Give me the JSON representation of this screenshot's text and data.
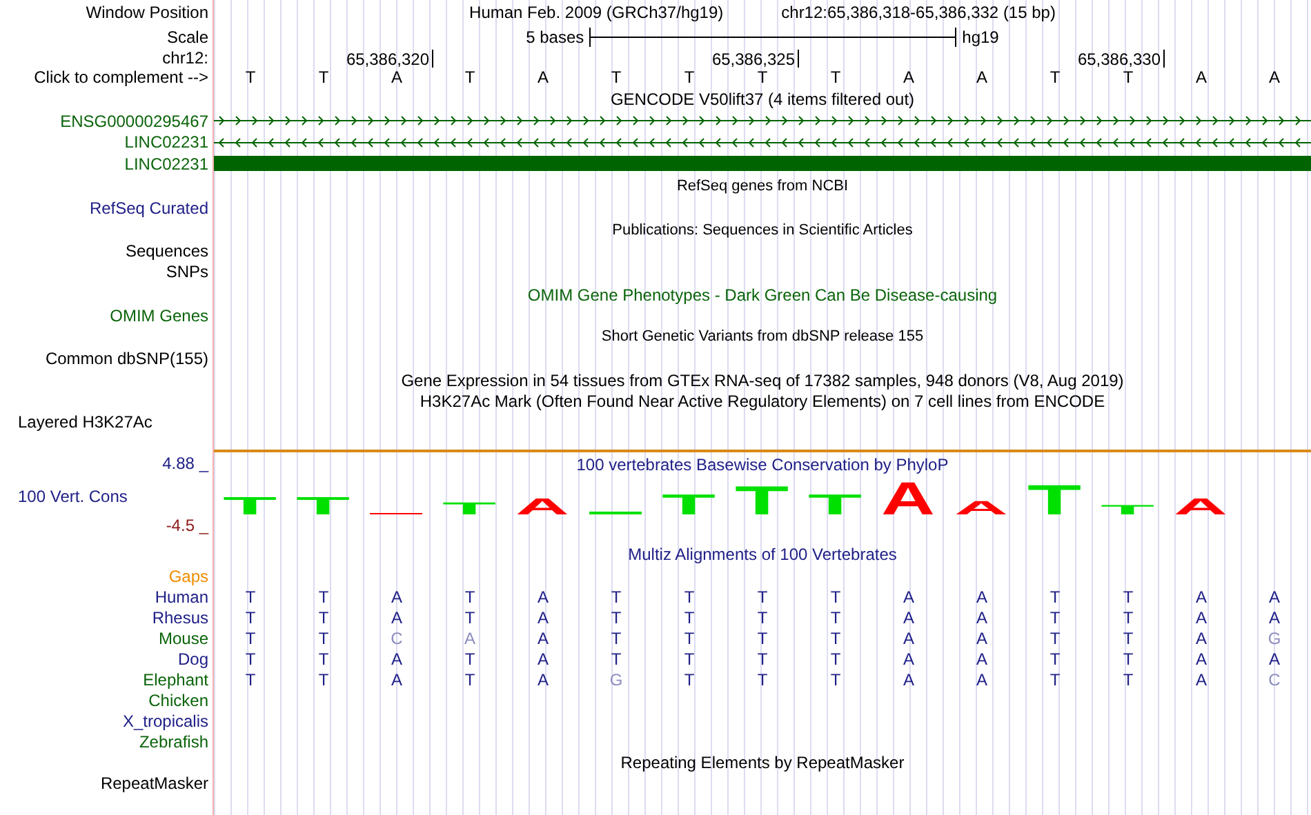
{
  "ruler": {
    "position_label": "Window Position",
    "assembly": "Human Feb. 2009 (GRCh37/hg19)",
    "position": "chr12:65,386,318-65,386,332 (15 bp)",
    "scale_label": "Scale",
    "scale_text": "5 bases",
    "scale_assembly": "hg19",
    "chrom_label": "chr12:",
    "complement_label": "Click to complement -->",
    "bases": [
      {
        "base": "T"
      },
      {
        "base": "T"
      },
      {
        "base": "A",
        "tick": "65,386,320"
      },
      {
        "base": "T"
      },
      {
        "base": "A"
      },
      {
        "base": "T"
      },
      {
        "base": "T"
      },
      {
        "base": "T",
        "tick": "65,386,325"
      },
      {
        "base": "T"
      },
      {
        "base": "A"
      },
      {
        "base": "A"
      },
      {
        "base": "T"
      },
      {
        "base": "T",
        "tick": "65,386,330"
      },
      {
        "base": "A"
      },
      {
        "base": "A"
      }
    ]
  },
  "gencode": {
    "title": "GENCODE V50lift37 (4 items filtered out)",
    "items": [
      {
        "name": "ENSG00000295467",
        "kind": "forward"
      },
      {
        "name": "LINC02231",
        "kind": "reverse"
      },
      {
        "name": "LINC02231",
        "kind": "exon"
      }
    ]
  },
  "refseq": {
    "title": "RefSeq genes from NCBI",
    "label": "RefSeq Curated"
  },
  "publications": {
    "title": "Publications: Sequences in Scientific Articles",
    "labels": [
      "Sequences",
      "SNPs"
    ]
  },
  "omim": {
    "title": "OMIM Gene Phenotypes - Dark Green Can Be Disease-causing",
    "label": "OMIM Genes"
  },
  "dbsnp": {
    "title": "Short Genetic Variants from dbSNP release 155",
    "label": "Common dbSNP(155)"
  },
  "gtex": {
    "title": "Gene Expression in 54 tissues from GTEx RNA-seq of 17382 samples, 948 donors (V8, Aug 2019)"
  },
  "h3k27ac": {
    "title": "H3K27Ac Mark (Often Found Near Active Regulatory Elements) on 7 cell lines from ENCODE",
    "label": "Layered H3K27Ac"
  },
  "conservation": {
    "title": "100 vertebrates Basewise Conservation by PhyloP",
    "label": "100 Vert. Cons",
    "max": "4.88 _",
    "min": "-4.5 _",
    "logo": [
      {
        "base": "T",
        "kind": "conserved"
      },
      {
        "base": "T",
        "kind": "conserved"
      },
      {
        "kind": "accelerated"
      },
      {
        "base": "T",
        "kind": "conserved"
      },
      {
        "base": "A",
        "kind": "accelerated"
      },
      {
        "kind": "conserved"
      },
      {
        "base": "T",
        "kind": "conserved"
      },
      {
        "base": "T",
        "kind": "conserved"
      },
      {
        "base": "T",
        "kind": "conserved"
      },
      {
        "base": "A",
        "kind": "accelerated"
      },
      {
        "base": "A",
        "kind": "accelerated"
      },
      {
        "base": "T",
        "kind": "conserved"
      },
      {
        "base": "T",
        "kind": "conserved"
      },
      {
        "base": "A",
        "kind": "accelerated"
      }
    ]
  },
  "multiz": {
    "title": "Multiz Alignments of 100 Vertebrates",
    "gaps_label": "Gaps",
    "species": [
      {
        "name": "Human",
        "color": "#202088",
        "bases": [
          {
            "base": "T",
            "mismatch": false
          },
          {
            "base": "T",
            "mismatch": false
          },
          {
            "base": "A",
            "mismatch": false
          },
          {
            "base": "T",
            "mismatch": false
          },
          {
            "base": "A",
            "mismatch": false
          },
          {
            "base": "T",
            "mismatch": false
          },
          {
            "base": "T",
            "mismatch": false
          },
          {
            "base": "T",
            "mismatch": false
          },
          {
            "base": "T",
            "mismatch": false
          },
          {
            "base": "A",
            "mismatch": false
          },
          {
            "base": "A",
            "mismatch": false
          },
          {
            "base": "T",
            "mismatch": false
          },
          {
            "base": "T",
            "mismatch": false
          },
          {
            "base": "A",
            "mismatch": false
          },
          {
            "base": "A",
            "mismatch": false
          }
        ]
      },
      {
        "name": "Rhesus",
        "color": "#202088",
        "bases": [
          {
            "base": "T",
            "mismatch": false
          },
          {
            "base": "T",
            "mismatch": false
          },
          {
            "base": "A",
            "mismatch": false
          },
          {
            "base": "T",
            "mismatch": false
          },
          {
            "base": "A",
            "mismatch": false
          },
          {
            "base": "T",
            "mismatch": false
          },
          {
            "base": "T",
            "mismatch": false
          },
          {
            "base": "T",
            "mismatch": false
          },
          {
            "base": "T",
            "mismatch": false
          },
          {
            "base": "A",
            "mismatch": false
          },
          {
            "base": "A",
            "mismatch": false
          },
          {
            "base": "T",
            "mismatch": false
          },
          {
            "base": "T",
            "mismatch": false
          },
          {
            "base": "A",
            "mismatch": false
          },
          {
            "base": "A",
            "mismatch": false
          }
        ]
      },
      {
        "name": "Mouse",
        "color": "#0a640a",
        "bases": [
          {
            "base": "T",
            "mismatch": false
          },
          {
            "base": "T",
            "mismatch": false
          },
          {
            "base": "C",
            "mismatch": true
          },
          {
            "base": "A",
            "mismatch": true
          },
          {
            "base": "A",
            "mismatch": false
          },
          {
            "base": "T",
            "mismatch": false
          },
          {
            "base": "T",
            "mismatch": false
          },
          {
            "base": "T",
            "mismatch": false
          },
          {
            "base": "T",
            "mismatch": false
          },
          {
            "base": "A",
            "mismatch": false
          },
          {
            "base": "A",
            "mismatch": false
          },
          {
            "base": "T",
            "mismatch": false
          },
          {
            "base": "T",
            "mismatch": false
          },
          {
            "base": "A",
            "mismatch": false
          },
          {
            "base": "G",
            "mismatch": true
          }
        ]
      },
      {
        "name": "Dog",
        "color": "#202088",
        "bases": [
          {
            "base": "T",
            "mismatch": false
          },
          {
            "base": "T",
            "mismatch": false
          },
          {
            "base": "A",
            "mismatch": false
          },
          {
            "base": "T",
            "mismatch": false
          },
          {
            "base": "A",
            "mismatch": false
          },
          {
            "base": "T",
            "mismatch": false
          },
          {
            "base": "T",
            "mismatch": false
          },
          {
            "base": "T",
            "mismatch": false
          },
          {
            "base": "T",
            "mismatch": false
          },
          {
            "base": "A",
            "mismatch": false
          },
          {
            "base": "A",
            "mismatch": false
          },
          {
            "base": "T",
            "mismatch": false
          },
          {
            "base": "T",
            "mismatch": false
          },
          {
            "base": "A",
            "mismatch": false
          },
          {
            "base": "A",
            "mismatch": false
          }
        ]
      },
      {
        "name": "Elephant",
        "color": "#0a640a",
        "bases": [
          {
            "base": "T",
            "mismatch": false
          },
          {
            "base": "T",
            "mismatch": false
          },
          {
            "base": "A",
            "mismatch": false
          },
          {
            "base": "T",
            "mismatch": false
          },
          {
            "base": "A",
            "mismatch": false
          },
          {
            "base": "G",
            "mismatch": true
          },
          {
            "base": "T",
            "mismatch": false
          },
          {
            "base": "T",
            "mismatch": false
          },
          {
            "base": "T",
            "mismatch": false
          },
          {
            "base": "A",
            "mismatch": false
          },
          {
            "base": "A",
            "mismatch": false
          },
          {
            "base": "T",
            "mismatch": false
          },
          {
            "base": "T",
            "mismatch": false
          },
          {
            "base": "A",
            "mismatch": false
          },
          {
            "base": "C",
            "mismatch": true
          }
        ]
      },
      {
        "name": "Chicken",
        "color": "#0a640a"
      },
      {
        "name": "X_tropicalis",
        "color": "#202088"
      },
      {
        "name": "Zebrafish",
        "color": "#0a640a"
      }
    ]
  },
  "repeatmasker": {
    "title": "Repeating Elements by RepeatMasker",
    "label": "RepeatMasker"
  }
}
